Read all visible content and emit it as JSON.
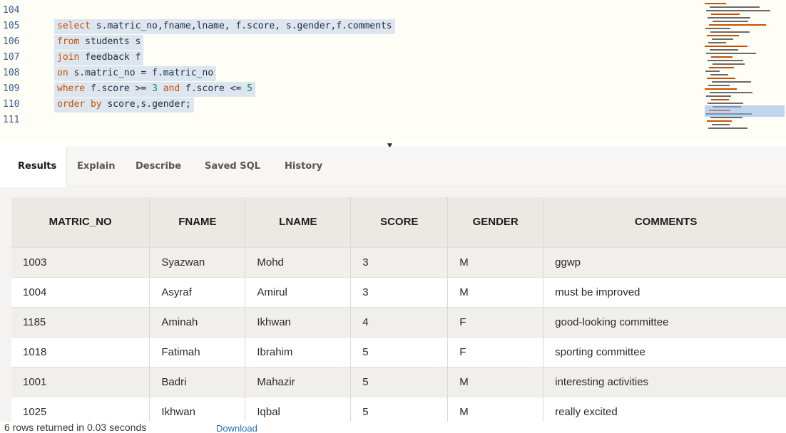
{
  "editor": {
    "lines": [
      {
        "num": "104",
        "tokens": []
      },
      {
        "num": "105",
        "tokens": [
          {
            "t": "select",
            "c": "kw"
          },
          {
            "t": " s.matric_no,fname,lname, f.score, s.gender,f.comments",
            "c": "id"
          }
        ]
      },
      {
        "num": "106",
        "tokens": [
          {
            "t": "from",
            "c": "kw"
          },
          {
            "t": " students s",
            "c": "id"
          }
        ]
      },
      {
        "num": "107",
        "tokens": [
          {
            "t": "join",
            "c": "kw"
          },
          {
            "t": " feedback f",
            "c": "id"
          }
        ]
      },
      {
        "num": "108",
        "tokens": [
          {
            "t": "on",
            "c": "kw"
          },
          {
            "t": " s.matric_no = f.matric_no",
            "c": "id"
          }
        ]
      },
      {
        "num": "109",
        "tokens": [
          {
            "t": "where",
            "c": "kw"
          },
          {
            "t": " f.score >= ",
            "c": "id"
          },
          {
            "t": "3",
            "c": "num"
          },
          {
            "t": " and ",
            "c": "kw"
          },
          {
            "t": "f.score <= ",
            "c": "id"
          },
          {
            "t": "5",
            "c": "num"
          }
        ]
      },
      {
        "num": "110",
        "tokens": [
          {
            "t": "order by",
            "c": "kw"
          },
          {
            "t": " score,s.gender;",
            "c": "id"
          }
        ]
      },
      {
        "num": "111",
        "tokens": []
      }
    ]
  },
  "tabs": [
    {
      "label": "Results",
      "active": true
    },
    {
      "label": "Explain",
      "active": false
    },
    {
      "label": "Describe",
      "active": false
    },
    {
      "label": "Saved SQL",
      "active": false
    },
    {
      "label": "History",
      "active": false
    }
  ],
  "table": {
    "headers": [
      "MATRIC_NO",
      "FNAME",
      "LNAME",
      "SCORE",
      "GENDER",
      "COMMENTS"
    ],
    "rows": [
      [
        "1003",
        "Syazwan",
        "Mohd",
        "3",
        "M",
        "ggwp"
      ],
      [
        "1004",
        "Asyraf",
        "Amirul",
        "3",
        "M",
        "must be improved"
      ],
      [
        "1185",
        "Aminah",
        "Ikhwan",
        "4",
        "F",
        "good-looking committee"
      ],
      [
        "1018",
        "Fatimah",
        "Ibrahim",
        "5",
        "F",
        "sporting committee"
      ],
      [
        "1001",
        "Badri",
        "Mahazir",
        "5",
        "M",
        "interesting activities"
      ],
      [
        "1025",
        "Ikhwan",
        "Iqbal",
        "5",
        "M",
        "really excited"
      ]
    ]
  },
  "footer": {
    "row_count_text": "6 rows returned in 0.03 seconds",
    "download_label": "Download"
  },
  "colors": {
    "keyword": "#c75000",
    "number": "#0f8a6a",
    "line_number": "#3a5a8c",
    "selection": "#dde6ef",
    "link": "#2a6ebb"
  },
  "icons": {
    "scroll_indicator": "caret-down-icon"
  }
}
